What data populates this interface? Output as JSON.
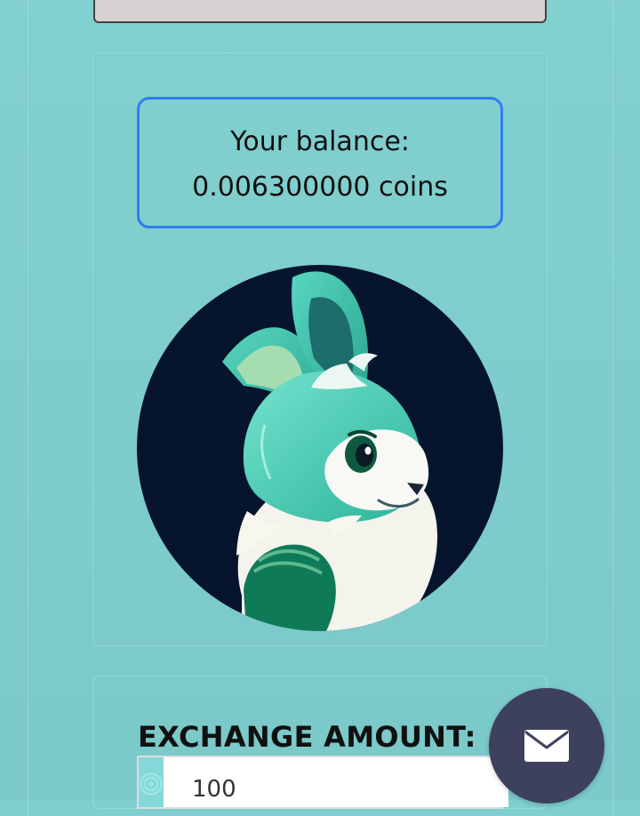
{
  "balance": {
    "label": "Your balance:",
    "amount": "0.006300000 coins"
  },
  "exchange": {
    "label": "EXCHANGE AMOUNT:",
    "value": "100"
  },
  "icons": {
    "avatar": "bunny-avatar",
    "input": "target-icon",
    "mail": "mail-icon"
  },
  "colors": {
    "background": "#7fcfcf",
    "balance_border": "#2f7df0",
    "mail_button": "#3e415e"
  }
}
